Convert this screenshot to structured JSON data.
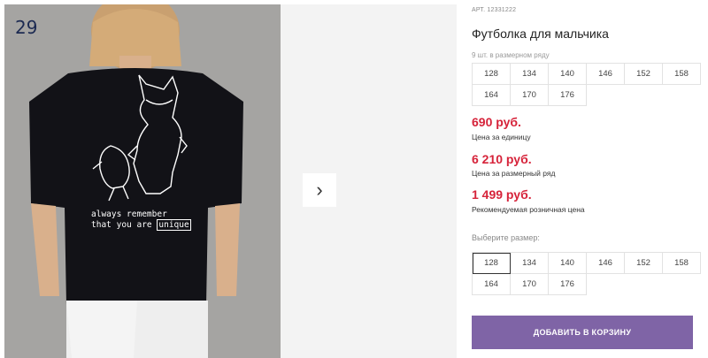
{
  "gallery": {
    "photo_number": "29",
    "print_text_line1": "always remember",
    "print_text_line2": "that you are",
    "print_text_highlight": "unique",
    "next_icon": "chevron-right-icon"
  },
  "product": {
    "article": "АРТ. 12331222",
    "title": "Футболка для мальчика",
    "sizes_hint": "9 шт. в размерном ряду",
    "size_row_sizes": [
      "128",
      "134",
      "140",
      "146",
      "152",
      "158",
      "164",
      "170",
      "176"
    ],
    "prices": [
      {
        "value": "690 руб.",
        "label": "Цена за единицу"
      },
      {
        "value": "6 210 руб.",
        "label": "Цена за размерный ряд"
      },
      {
        "value": "1 499 руб.",
        "label": "Рекомендуемая розничная цена"
      }
    ],
    "select_label": "Выберите размер:",
    "selectable_sizes": [
      "128",
      "134",
      "140",
      "146",
      "152",
      "158",
      "164",
      "170",
      "176"
    ],
    "selected_size": "128",
    "add_to_cart": "ДОБАВИТЬ В КОРЗИНУ"
  },
  "colors": {
    "price": "#d6233a",
    "accent_button": "#7f64a6"
  }
}
